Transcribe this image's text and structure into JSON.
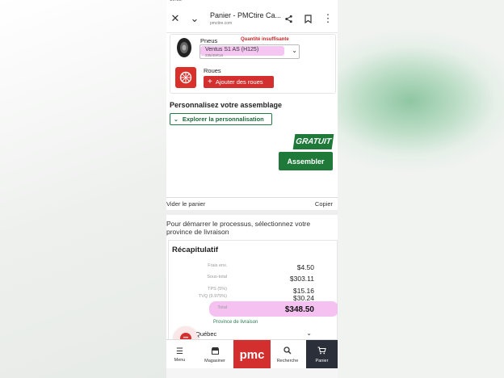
{
  "browser": {
    "title": "Panier - PMCtire Ca...",
    "url": "pmctire.com",
    "icons": [
      "close-icon",
      "chevron-down-icon",
      "share-icon",
      "bookmark-icon",
      "more-vert-icon"
    ]
  },
  "cart": {
    "tires_label": "Pneus",
    "warning": "Quantité insuffisante",
    "tire_model": "Ventus S1 AS (H125)",
    "tire_size": "235/45R18",
    "wheels_label": "Roues",
    "add_wheels": "Ajouter des roues"
  },
  "customize": {
    "title": "Personnalisez votre assemblage",
    "explore": "Explorer la personnalisation",
    "badge": "GRATUIT",
    "assemble": "Assembler"
  },
  "actions": {
    "clear": "Vider le panier",
    "copy": "Copier"
  },
  "province_message": "Pour démarrer le processus, sélectionnez votre province de livraison",
  "summary": {
    "title": "Récapitulatif",
    "rows": [
      {
        "label": "Frais env.",
        "value": "$4.50"
      },
      {
        "label": "Sous-total",
        "value": "$303.11"
      },
      {
        "label": "TPS (5%)",
        "value": "$15.16"
      },
      {
        "label": "TVQ (9.975%)",
        "value": "$30.24"
      },
      {
        "label": "Total",
        "value": "$348.50"
      }
    ],
    "province_label": "Province de livraison",
    "province_value": "Québec"
  },
  "nav": {
    "menu": "Menu",
    "stores": "Magasiner",
    "logo": "pmc",
    "search": "Recherche",
    "cart": "Panier"
  },
  "colors": {
    "brand_red": "#d32f2f",
    "green": "#1f7a3a",
    "highlight": "#f2b6ef"
  }
}
